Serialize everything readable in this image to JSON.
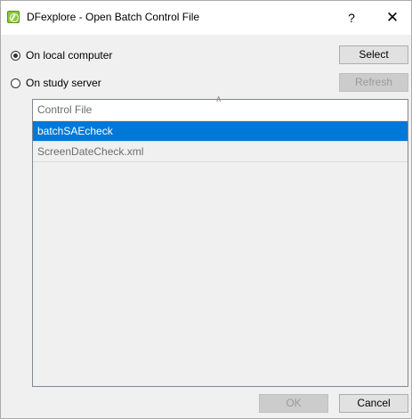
{
  "window": {
    "title": "DFexplore - Open Batch Control File",
    "help_label": "?",
    "close_label": "✕"
  },
  "source": {
    "local_label": "On local computer",
    "server_label": "On study server",
    "selected": "local"
  },
  "buttons": {
    "select": "Select",
    "refresh": "Refresh",
    "ok": "OK",
    "cancel": "Cancel"
  },
  "file_list": {
    "header": "Control File",
    "rows": [
      {
        "name": "batchSAEcheck",
        "selected": true
      },
      {
        "name": "ScreenDateCheck.xml",
        "selected": false
      }
    ]
  }
}
